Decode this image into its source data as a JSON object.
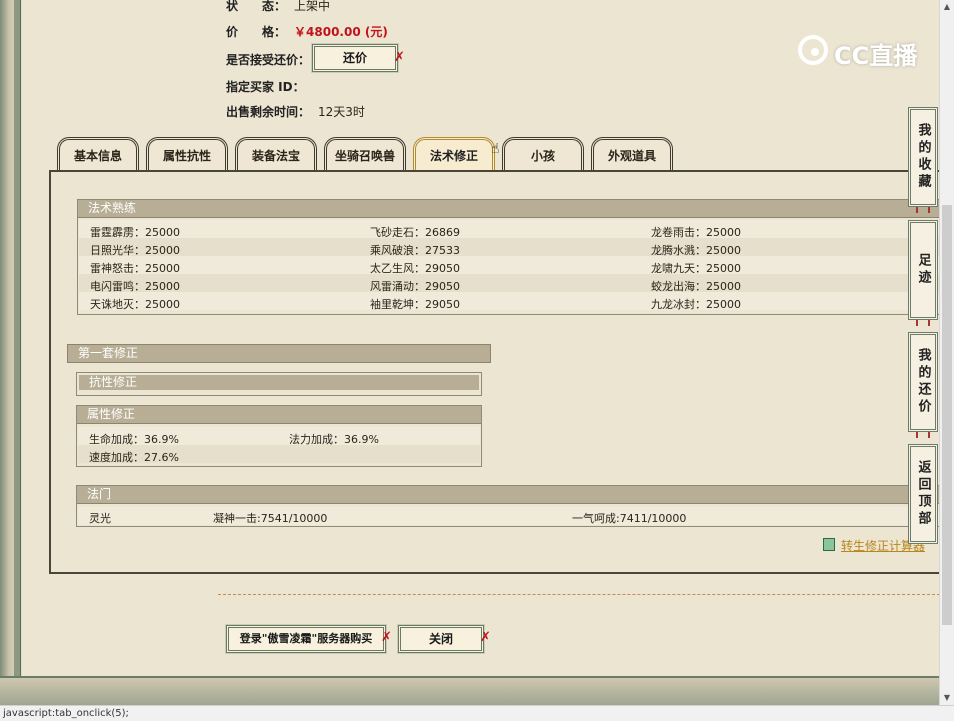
{
  "listing": {
    "status_label": "状　　态：",
    "status_value": "上架中",
    "price_label": "价　　格：",
    "price_value": "￥4800.00 (元)",
    "bargain_label": "是否接受还价：",
    "bargain_button": "还价",
    "buyer_id_label": "指定买家 ID：",
    "time_left_label": "出售剩余时间：",
    "time_left_value": "12天3时"
  },
  "watermark": "CC直播",
  "tabs": [
    {
      "label": "基本信息"
    },
    {
      "label": "属性抗性"
    },
    {
      "label": "装备法宝"
    },
    {
      "label": "坐骑召唤兽"
    },
    {
      "label": "法术修正",
      "active": true
    },
    {
      "label": "小孩"
    },
    {
      "label": "外观道具"
    }
  ],
  "spell_mastery": {
    "title": "法术熟练",
    "rows": [
      [
        "雷霆霹雳：25000",
        "飞砂走石：26869",
        "龙卷雨击：25000"
      ],
      [
        "日照光华：25000",
        "乘风破浪：27533",
        "龙腾水溅：25000"
      ],
      [
        "雷神怒击：25000",
        "太乙生风：29050",
        "龙啸九天：25000"
      ],
      [
        "电闪雷鸣：25000",
        "风雷涌动：29050",
        "蛟龙出海：25000"
      ],
      [
        "天诛地灭：25000",
        "袖里乾坤：29050",
        "九龙冰封：25000"
      ]
    ]
  },
  "correction_set": {
    "title": "第一套修正",
    "resist_title": "抗性修正",
    "attr_title": "属性修正",
    "attrs": [
      "生命加成：36.9%",
      "法力加成：36.9%",
      "速度加成：27.6%"
    ]
  },
  "fa_men": {
    "title": "法门",
    "items": [
      "灵光",
      "凝神一击:7541/10000",
      "一气呵成:7411/10000"
    ]
  },
  "calc_link": "转生修正计算器",
  "buttons": {
    "login_buy": "登录\"傲雪凌霜\"服务器购买",
    "close": "关闭",
    "x_mark": "✗"
  },
  "sidebar": [
    "我的收藏",
    "足迹",
    "我的还价",
    "返回顶部"
  ],
  "statusbar": "javascript:tab_onclick(5);",
  "colors": {
    "price": "#c2121a",
    "header": "#b7ae95",
    "link": "#b8861a"
  }
}
